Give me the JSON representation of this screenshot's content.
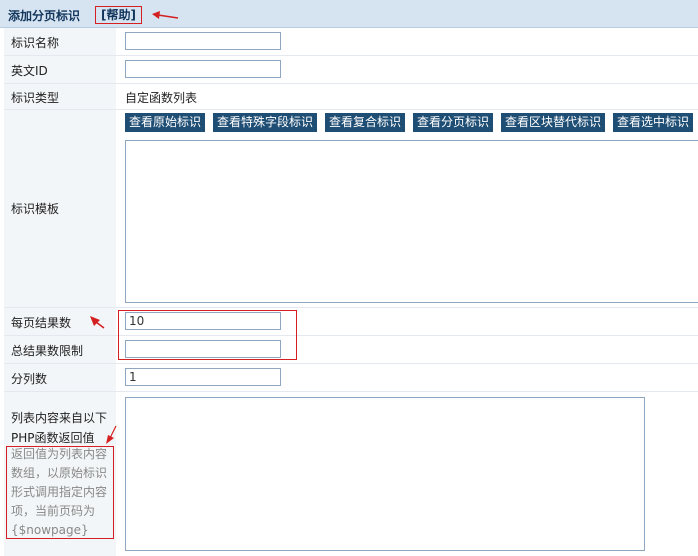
{
  "header": {
    "title": "添加分页标识",
    "help_label": "[帮助]"
  },
  "fields": {
    "name": {
      "label": "标识名称",
      "value": ""
    },
    "english_id": {
      "label": "英文ID",
      "value": ""
    },
    "type": {
      "label": "标识类型",
      "value": "自定函数列表"
    },
    "template": {
      "label": "标识模板",
      "buttons": [
        "查看原始标识",
        "查看特殊字段标识",
        "查看复合标识",
        "查看分页标识",
        "查看区块替代标识",
        "查看选中标识"
      ]
    },
    "per_page": {
      "label": "每页结果数",
      "value": "10"
    },
    "total_limit": {
      "label": "总结果数限制",
      "value": ""
    },
    "columns": {
      "label": "分列数",
      "value": "1"
    },
    "php_list": {
      "label_line1": "列表内容来自以下",
      "label_line2": "PHP函数返回值",
      "hint_lines": [
        "返回值为列表内容",
        "数组，以原始标识",
        "形式调用指定内容",
        "项，当前页码为",
        "{$nowpage}"
      ]
    }
  },
  "colors": {
    "header_bg": "#d6e4f2",
    "button_bg": "#1f4e74",
    "annotation": "#d42020"
  }
}
